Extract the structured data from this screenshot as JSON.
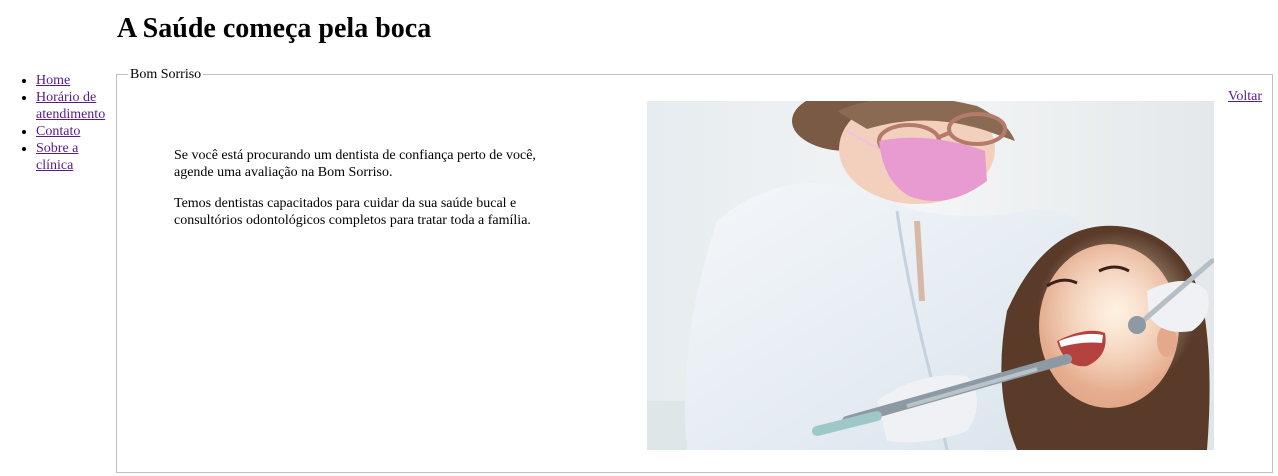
{
  "header": {
    "title": "A Saúde começa pela boca"
  },
  "nav": {
    "items": [
      {
        "label": "Home"
      },
      {
        "label": "Horário de atendimento"
      },
      {
        "label": "Contato"
      },
      {
        "label": "Sobre a clínica"
      }
    ]
  },
  "main": {
    "legend": "Bom Sorriso",
    "back_label": "Voltar",
    "paragraphs": [
      "Se você está procurando um dentista de confiança perto de você, agende uma avaliação na Bom Sorriso.",
      "Temos dentistas capacitados para cuidar da sua saúde bucal e consultórios odontológicos completos para tratar toda a família."
    ],
    "hero_icon": "dentist-patient-photo"
  },
  "colors": {
    "link_visited": "#551a8b",
    "fieldset_border": "#c0c0c0",
    "mask_pink": "#e79bd0",
    "coat_white": "#e7eef5",
    "hair_brown": "#5a3a28"
  }
}
